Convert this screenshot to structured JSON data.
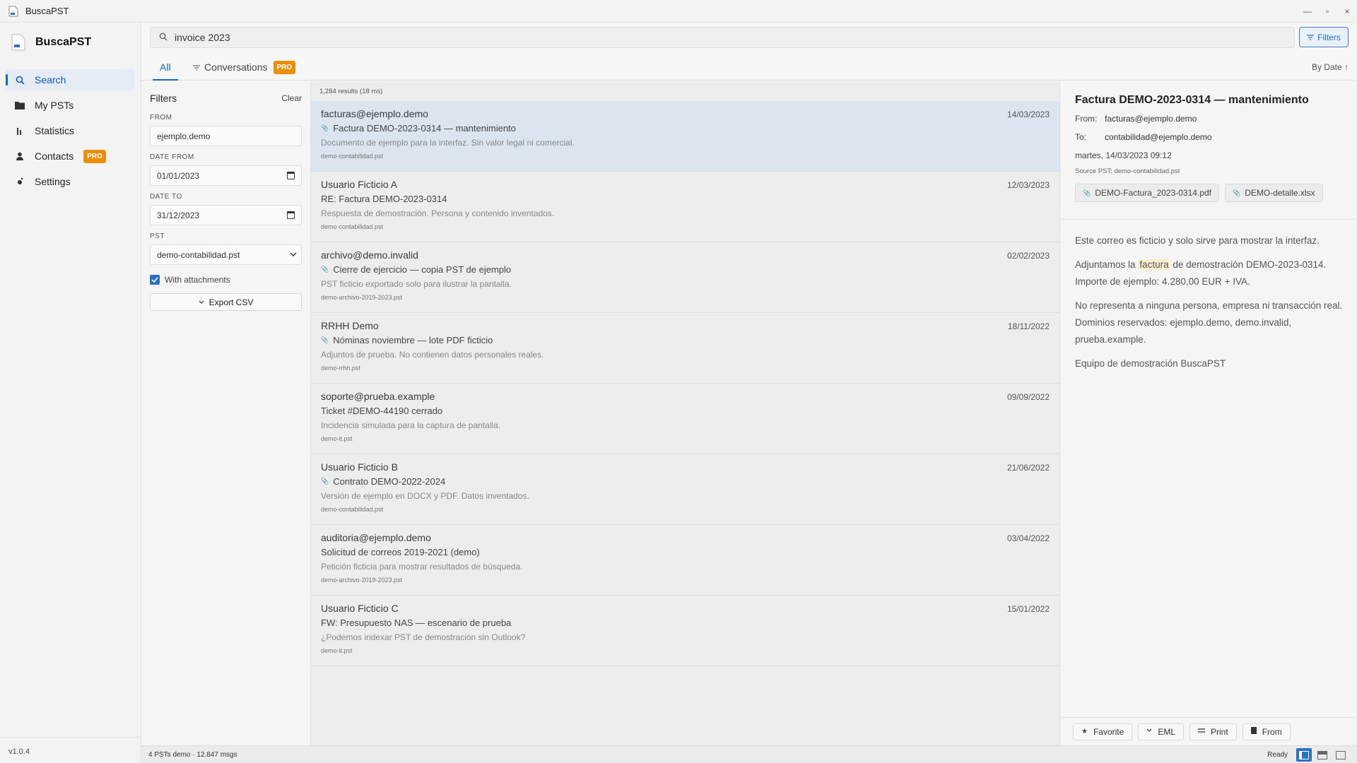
{
  "window": {
    "title": "BuscaPST",
    "minimize": "—",
    "maximize": "▫",
    "close": "×"
  },
  "sidebar": {
    "brand": "BuscaPST",
    "items": [
      {
        "label": "Search",
        "icon": "search-icon",
        "active": true
      },
      {
        "label": "My PSTs",
        "icon": "folder-icon"
      },
      {
        "label": "Statistics",
        "icon": "bar-chart-icon"
      },
      {
        "label": "Contacts",
        "icon": "person-icon",
        "badge": "PRO"
      },
      {
        "label": "Settings",
        "icon": "gear-icon"
      }
    ],
    "version": "v1.0.4"
  },
  "search": {
    "value": "invoice 2023",
    "filters_label": "Filters"
  },
  "tabs": {
    "all": "All",
    "conversations": "Conversations",
    "conversations_badge": "PRO",
    "sort": "By Date ↑"
  },
  "filters": {
    "title": "Filters",
    "clear": "Clear",
    "from_label": "FROM",
    "from_value": "ejemplo.demo",
    "date_from_label": "DATE FROM",
    "date_from_value": "01/01/2023",
    "date_to_label": "DATE TO",
    "date_to_value": "31/12/2023",
    "pst_label": "PST",
    "pst_value": "demo-contabilidad.pst",
    "attachments_label": "With attachments",
    "export_label": "Export CSV"
  },
  "results": {
    "count": "1,284 results (18 ms)",
    "items": [
      {
        "sender": "facturas@ejemplo.demo",
        "date": "14/03/2023",
        "subject": "Factura DEMO-2023-0314 — mantenimiento",
        "attachment": true,
        "preview": "Documento de ejemplo para la interfaz. Sin valor legal ni comercial.",
        "file": "demo-contabilidad.pst",
        "selected": true
      },
      {
        "sender": "Usuario Ficticio A",
        "date": "12/03/2023",
        "subject": "RE: Factura DEMO-2023-0314",
        "attachment": false,
        "preview": "Respuesta de demostración. Persona y contenido inventados.",
        "file": "demo-contabilidad.pst"
      },
      {
        "sender": "archivo@demo.invalid",
        "date": "02/02/2023",
        "subject": "Cierre de ejercicio — copia PST de ejemplo",
        "attachment": true,
        "preview": "PST ficticio exportado solo para ilustrar la pantalla.",
        "file": "demo-archivo-2019-2023.pst"
      },
      {
        "sender": "RRHH Demo",
        "date": "18/11/2022",
        "subject": "Nóminas noviembre — lote PDF ficticio",
        "attachment": true,
        "preview": "Adjuntos de prueba. No contienen datos personales reales.",
        "file": "demo-rrhh.pst"
      },
      {
        "sender": "soporte@prueba.example",
        "date": "09/09/2022",
        "subject": "Ticket #DEMO-44190 cerrado",
        "attachment": false,
        "preview": "Incidencia simulada para la captura de pantalla.",
        "file": "demo-it.pst"
      },
      {
        "sender": "Usuario Ficticio B",
        "date": "21/06/2022",
        "subject": "Contrato DEMO-2022-2024",
        "attachment": true,
        "preview": "Versión de ejemplo en DOCX y PDF. Datos inventados.",
        "file": "demo-contabilidad.pst"
      },
      {
        "sender": "auditoria@ejemplo.demo",
        "date": "03/04/2022",
        "subject": "Solicitud de correos 2019-2021 (demo)",
        "attachment": false,
        "preview": "Petición ficticia para mostrar resultados de búsqueda.",
        "file": "demo-archivo-2019-2023.pst"
      },
      {
        "sender": "Usuario Ficticio C",
        "date": "15/01/2022",
        "subject": "FW: Presupuesto NAS — escenario de prueba",
        "attachment": false,
        "preview": "¿Podemos indexar PST de demostración sin Outlook?",
        "file": "demo-it.pst"
      }
    ]
  },
  "preview": {
    "title": "Factura DEMO-2023-0314 — mantenimiento",
    "from_label": "From:",
    "from": "facturas@ejemplo.demo",
    "to_label": "To:",
    "to": "contabilidad@ejemplo.demo",
    "date": "martes, 14/03/2023 09:12",
    "source": "Source PST: demo-contabilidad.pst",
    "attachments": [
      "DEMO-Factura_2023-0314.pdf",
      "DEMO-detalle.xlsx"
    ],
    "body": {
      "p1": "Este correo es ficticio y solo sirve para mostrar la interfaz.",
      "p2_before": "Adjuntamos la",
      "p2_highlight": "factura",
      "p2_after": "de demostración DEMO-2023-0314. Importe de ejemplo: 4.280,00 EUR + IVA.",
      "p3": "No representa a ninguna persona, empresa ni transacción real. Dominios reservados: ejemplo.demo, demo.invalid, prueba.example.",
      "p4": "Equipo de demostración BuscaPST"
    },
    "actions": {
      "favorite": "Favorite",
      "eml": "EML",
      "print": "Print",
      "from": "From"
    }
  },
  "status": {
    "left": "4 PSTs demo · 12.847 msgs",
    "ready": "Ready"
  },
  "colors": {
    "accent": "#0f6cbd",
    "pro_badge": "#e8900c",
    "selected_row": "#dbe5f0",
    "highlight": "#fbefd1"
  }
}
